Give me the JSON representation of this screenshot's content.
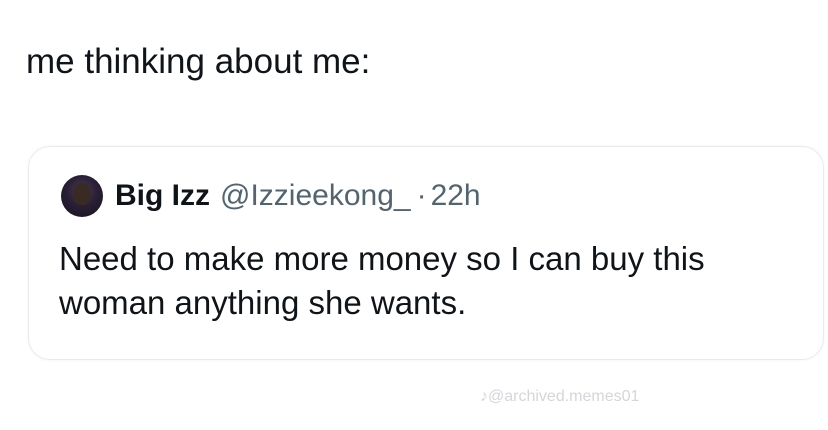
{
  "post": {
    "text": "me thinking about me:"
  },
  "quoted_tweet": {
    "display_name": "Big Izz",
    "handle": "@Izzieekong_",
    "separator": "·",
    "time": "22h",
    "body": "Need to make more money so I can buy this woman anything she wants."
  },
  "watermark": {
    "text": "♪@archived.memes01"
  }
}
